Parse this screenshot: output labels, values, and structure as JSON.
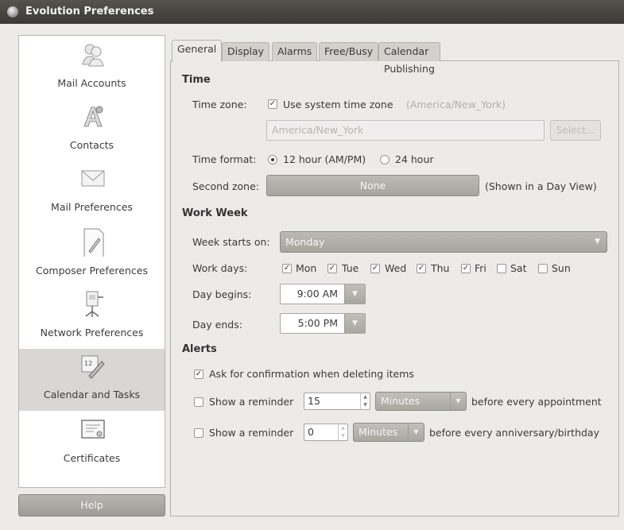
{
  "window": {
    "title": "Evolution Preferences"
  },
  "sidebar": {
    "items": [
      {
        "label": "Mail Accounts",
        "icon": "mail-accounts-icon"
      },
      {
        "label": "Contacts",
        "icon": "contacts-icon"
      },
      {
        "label": "Mail Preferences",
        "icon": "envelope-icon"
      },
      {
        "label": "Composer Preferences",
        "icon": "composer-icon"
      },
      {
        "label": "Network Preferences",
        "icon": "network-icon"
      },
      {
        "label": "Calendar and Tasks",
        "icon": "calendar-icon",
        "selected": true
      },
      {
        "label": "Certificates",
        "icon": "certificate-icon"
      }
    ],
    "help_label": "Help"
  },
  "tabs": [
    "General",
    "Display",
    "Alarms",
    "Free/Busy",
    "Calendar Publishing"
  ],
  "active_tab": "General",
  "time": {
    "section": "Time",
    "timezone_label": "Time zone:",
    "use_system_label": "Use system time zone",
    "system_zone_hint": "(America/New_York)",
    "zone_value": "America/New_York",
    "select_label": "Select...",
    "format_label": "Time format:",
    "format_12": "12 hour (AM/PM)",
    "format_24": "24 hour",
    "second_zone_label": "Second zone:",
    "second_zone_value": "None",
    "second_zone_hint": "(Shown in a Day View)"
  },
  "work_week": {
    "section": "Work Week",
    "week_starts_label": "Week starts on:",
    "week_starts_value": "Monday",
    "work_days_label": "Work days:",
    "days": [
      {
        "label": "Mon",
        "checked": true
      },
      {
        "label": "Tue",
        "checked": true
      },
      {
        "label": "Wed",
        "checked": true
      },
      {
        "label": "Thu",
        "checked": true
      },
      {
        "label": "Fri",
        "checked": true
      },
      {
        "label": "Sat",
        "checked": false
      },
      {
        "label": "Sun",
        "checked": false
      }
    ],
    "day_begins_label": "Day begins:",
    "day_begins_value": "9:00 AM",
    "day_ends_label": "Day ends:",
    "day_ends_value": "5:00 PM"
  },
  "alerts": {
    "section": "Alerts",
    "confirm_delete_label": "Ask for confirmation when deleting items",
    "reminder_label": "Show a reminder",
    "appt_value": "15",
    "appt_unit": "Minutes",
    "appt_suffix": "before every appointment",
    "anniv_value": "0",
    "anniv_unit": "Minutes",
    "anniv_suffix": "before every anniversary/birthday"
  }
}
